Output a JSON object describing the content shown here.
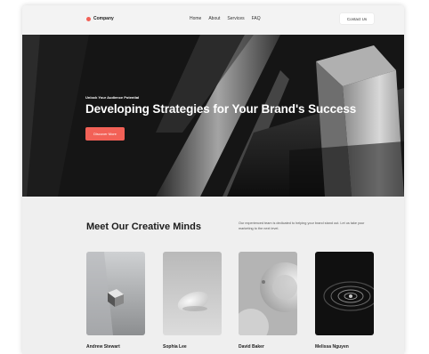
{
  "nav": {
    "logo_text": "Company",
    "links": [
      "Home",
      "About",
      "Services",
      "FAQ"
    ],
    "contact_label": "Contact Us"
  },
  "hero": {
    "eyebrow": "Unlock Your Audience Potential",
    "title": "Developing Strategies for Your Brand's Success",
    "cta_label": "Discover More"
  },
  "team": {
    "title": "Meet Our Creative Minds",
    "description": "Our experienced team is dedicated to helping your brand stand out. Let us take your marketing to the next level.",
    "members": [
      {
        "name": "Andrew Stewart"
      },
      {
        "name": "Sophia Lee"
      },
      {
        "name": "David Baker"
      },
      {
        "name": "Melissa Nguyen"
      }
    ]
  },
  "colors": {
    "accent": "#f26157",
    "hero_bg": "#161616",
    "page_bg": "#efefef"
  }
}
